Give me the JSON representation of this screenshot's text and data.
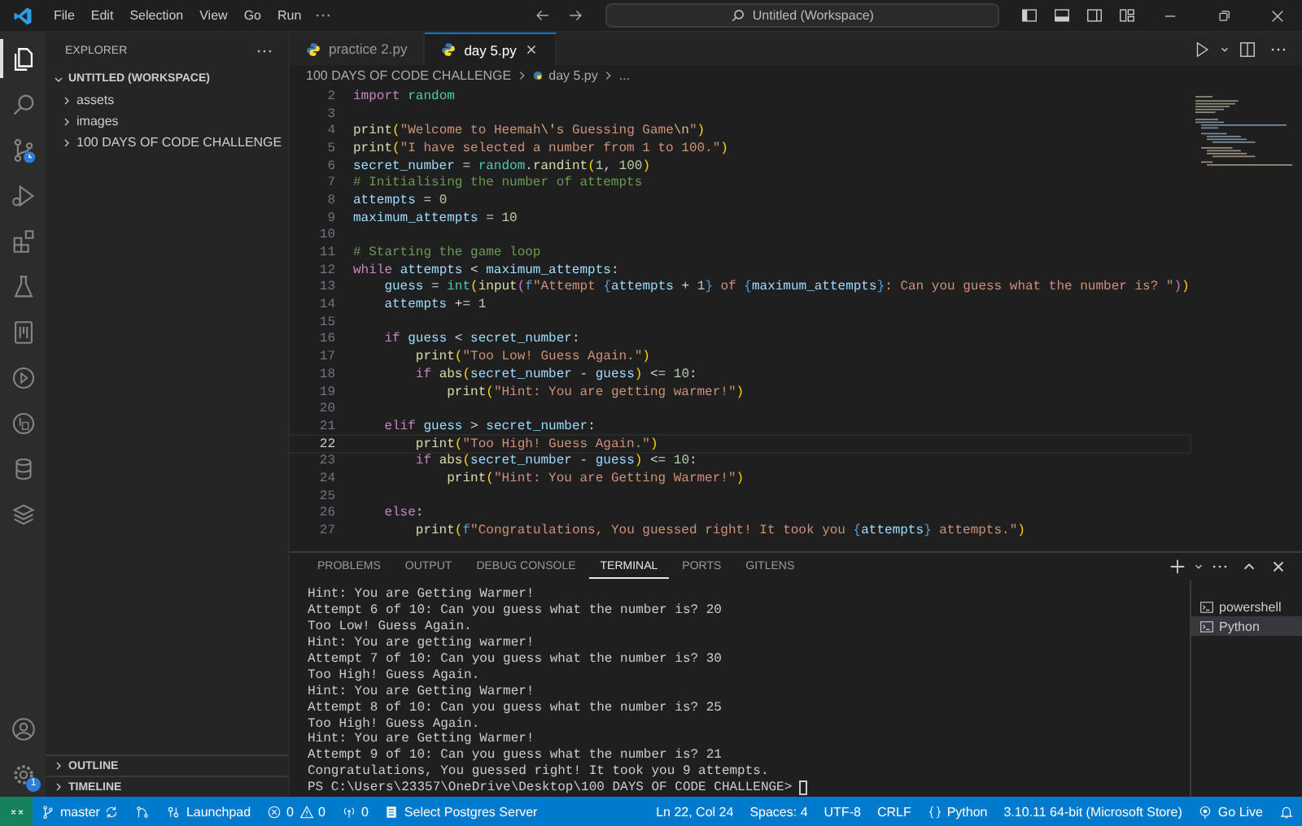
{
  "menu": [
    "File",
    "Edit",
    "Selection",
    "View",
    "Go",
    "Run"
  ],
  "command_center": "Untitled (Workspace)",
  "activity_bar": [
    {
      "kind": "files",
      "selected": true
    },
    {
      "kind": "search",
      "selected": false
    },
    {
      "kind": "branch",
      "selected": false
    },
    {
      "kind": "debug",
      "selected": false
    },
    {
      "kind": "blocks",
      "selected": false
    },
    {
      "kind": "flask",
      "selected": false
    },
    {
      "kind": "notebook",
      "selected": false
    },
    {
      "kind": "playcircle",
      "selected": false
    },
    {
      "kind": "dbcircle",
      "selected": false
    },
    {
      "kind": "database",
      "selected": false
    },
    {
      "kind": "layers",
      "selected": false
    }
  ],
  "settings_badge": "1",
  "sidebar": {
    "title": "EXPLORER",
    "workspace": {
      "label": "UNTITLED (WORKSPACE)",
      "expanded": true,
      "children": [
        {
          "label": "assets",
          "expanded": false
        },
        {
          "label": "images",
          "expanded": false
        },
        {
          "label": "100 DAYS OF CODE CHALLENGE",
          "expanded": false
        }
      ]
    },
    "sections": [
      {
        "label": "OUTLINE",
        "expanded": false
      },
      {
        "label": "TIMELINE",
        "expanded": false
      }
    ]
  },
  "tabs": [
    {
      "label": "practice 2.py",
      "selected": false
    },
    {
      "label": "day 5.py",
      "selected": true
    }
  ],
  "breadcrumb": {
    "folder": "100 DAYS OF CODE CHALLENGE",
    "file": "day 5.py",
    "more": "..."
  },
  "code": [
    {
      "number": "2",
      "current": false,
      "tokens": [
        {
          "kind": "keyword",
          "text": "import "
        },
        {
          "kind": "module",
          "text": "random"
        }
      ]
    },
    {
      "number": "3",
      "current": false
    },
    {
      "number": "4",
      "current": false,
      "tokens": [
        {
          "kind": "function",
          "text": "print"
        },
        {
          "kind": "paren",
          "text": "("
        },
        {
          "kind": "string",
          "text": "\"Welcome to Heemah"
        },
        {
          "kind": "escape",
          "text": "\\'"
        },
        {
          "kind": "string",
          "text": "s Guessing Game"
        },
        {
          "kind": "escape",
          "text": "\\n"
        },
        {
          "kind": "string",
          "text": "\""
        },
        {
          "kind": "paren",
          "text": ")"
        }
      ]
    },
    {
      "number": "5",
      "current": false,
      "tokens": [
        {
          "kind": "function",
          "text": "print"
        },
        {
          "kind": "paren",
          "text": "("
        },
        {
          "kind": "string",
          "text": "\"I have selected a number from 1 to 100.\""
        },
        {
          "kind": "paren",
          "text": ")"
        }
      ]
    },
    {
      "number": "6",
      "current": false,
      "tokens": [
        {
          "kind": "variable",
          "text": "secret_number"
        },
        {
          "kind": "plain",
          "text": " = "
        },
        {
          "kind": "module",
          "text": "random"
        },
        {
          "kind": "plain",
          "text": "."
        },
        {
          "kind": "function",
          "text": "randint"
        },
        {
          "kind": "paren",
          "text": "("
        },
        {
          "kind": "number",
          "text": "1"
        },
        {
          "kind": "plain",
          "text": ", "
        },
        {
          "kind": "number",
          "text": "100"
        },
        {
          "kind": "paren",
          "text": ")"
        }
      ]
    },
    {
      "number": "7",
      "current": false,
      "tokens": [
        {
          "kind": "comment",
          "text": "# Initialising the number of attempts"
        }
      ]
    },
    {
      "number": "8",
      "current": false,
      "tokens": [
        {
          "kind": "variable",
          "text": "attempts"
        },
        {
          "kind": "plain",
          "text": " = "
        },
        {
          "kind": "number",
          "text": "0"
        }
      ]
    },
    {
      "number": "9",
      "current": false,
      "tokens": [
        {
          "kind": "variable",
          "text": "maximum_attempts"
        },
        {
          "kind": "plain",
          "text": " = "
        },
        {
          "kind": "number",
          "text": "10"
        }
      ]
    },
    {
      "number": "10",
      "current": false
    },
    {
      "number": "11",
      "current": false,
      "tokens": [
        {
          "kind": "comment",
          "text": "# Starting the game loop"
        }
      ]
    },
    {
      "number": "12",
      "current": false,
      "tokens": [
        {
          "kind": "keyword",
          "text": "while "
        },
        {
          "kind": "variable",
          "text": "attempts"
        },
        {
          "kind": "plain",
          "text": " < "
        },
        {
          "kind": "variable",
          "text": "maximum_attempts"
        },
        {
          "kind": "plain",
          "text": ":"
        }
      ]
    },
    {
      "number": "13",
      "current": false,
      "tokens": [
        {
          "kind": "variable",
          "text": "    guess"
        },
        {
          "kind": "plain",
          "text": " = "
        },
        {
          "kind": "module",
          "text": "int"
        },
        {
          "kind": "paren",
          "text": "("
        },
        {
          "kind": "function",
          "text": "input"
        },
        {
          "kind": "paren2",
          "text": "("
        },
        {
          "kind": "brace",
          "text": "f"
        },
        {
          "kind": "string",
          "text": "\"Attempt "
        },
        {
          "kind": "brace",
          "text": "{"
        },
        {
          "kind": "variable",
          "text": "attempts"
        },
        {
          "kind": "plain",
          "text": " + "
        },
        {
          "kind": "number",
          "text": "1"
        },
        {
          "kind": "brace",
          "text": "}"
        },
        {
          "kind": "string",
          "text": " of "
        },
        {
          "kind": "brace",
          "text": "{"
        },
        {
          "kind": "variable",
          "text": "maximum_attempts"
        },
        {
          "kind": "brace",
          "text": "}"
        },
        {
          "kind": "string",
          "text": ": Can you guess what the number is? \""
        },
        {
          "kind": "paren2",
          "text": ")"
        },
        {
          "kind": "paren",
          "text": ")"
        }
      ]
    },
    {
      "number": "14",
      "current": false,
      "tokens": [
        {
          "kind": "variable",
          "text": "    attempts"
        },
        {
          "kind": "plain",
          "text": " += "
        },
        {
          "kind": "number",
          "text": "1"
        }
      ]
    },
    {
      "number": "15",
      "current": false
    },
    {
      "number": "16",
      "current": false,
      "tokens": [
        {
          "kind": "keyword",
          "text": "    if "
        },
        {
          "kind": "variable",
          "text": "guess"
        },
        {
          "kind": "plain",
          "text": " < "
        },
        {
          "kind": "variable",
          "text": "secret_number"
        },
        {
          "kind": "plain",
          "text": ":"
        }
      ]
    },
    {
      "number": "17",
      "current": false,
      "tokens": [
        {
          "kind": "function",
          "text": "        print"
        },
        {
          "kind": "paren",
          "text": "("
        },
        {
          "kind": "string",
          "text": "\"Too Low! Guess Again.\""
        },
        {
          "kind": "paren",
          "text": ")"
        }
      ]
    },
    {
      "number": "18",
      "current": false,
      "tokens": [
        {
          "kind": "keyword",
          "text": "        if "
        },
        {
          "kind": "function",
          "text": "abs"
        },
        {
          "kind": "paren",
          "text": "("
        },
        {
          "kind": "variable",
          "text": "secret_number"
        },
        {
          "kind": "plain",
          "text": " - "
        },
        {
          "kind": "variable",
          "text": "guess"
        },
        {
          "kind": "paren",
          "text": ")"
        },
        {
          "kind": "plain",
          "text": " <= "
        },
        {
          "kind": "number",
          "text": "10"
        },
        {
          "kind": "plain",
          "text": ":"
        }
      ]
    },
    {
      "number": "19",
      "current": false,
      "tokens": [
        {
          "kind": "function",
          "text": "            print"
        },
        {
          "kind": "paren",
          "text": "("
        },
        {
          "kind": "string",
          "text": "\"Hint: You are getting warmer!\""
        },
        {
          "kind": "paren",
          "text": ")"
        }
      ]
    },
    {
      "number": "20",
      "current": false
    },
    {
      "number": "21",
      "current": false,
      "tokens": [
        {
          "kind": "keyword",
          "text": "    elif "
        },
        {
          "kind": "variable",
          "text": "guess"
        },
        {
          "kind": "plain",
          "text": " > "
        },
        {
          "kind": "variable",
          "text": "secret_number"
        },
        {
          "kind": "plain",
          "text": ":"
        }
      ]
    },
    {
      "number": "22",
      "current": true,
      "tokens": [
        {
          "kind": "function",
          "text": "        print"
        },
        {
          "kind": "paren",
          "text": "("
        },
        {
          "kind": "string",
          "text": "\"Too High! Guess Again.\""
        },
        {
          "kind": "paren",
          "text": ")"
        }
      ]
    },
    {
      "number": "23",
      "current": false,
      "tokens": [
        {
          "kind": "keyword",
          "text": "        if "
        },
        {
          "kind": "function",
          "text": "abs"
        },
        {
          "kind": "paren",
          "text": "("
        },
        {
          "kind": "variable",
          "text": "secret_number"
        },
        {
          "kind": "plain",
          "text": " - "
        },
        {
          "kind": "variable",
          "text": "guess"
        },
        {
          "kind": "paren",
          "text": ")"
        },
        {
          "kind": "plain",
          "text": " <= "
        },
        {
          "kind": "number",
          "text": "10"
        },
        {
          "kind": "plain",
          "text": ":"
        }
      ]
    },
    {
      "number": "24",
      "current": false,
      "tokens": [
        {
          "kind": "function",
          "text": "            print"
        },
        {
          "kind": "paren",
          "text": "("
        },
        {
          "kind": "string",
          "text": "\"Hint: You are Getting Warmer!\""
        },
        {
          "kind": "paren",
          "text": ")"
        }
      ]
    },
    {
      "number": "25",
      "current": false
    },
    {
      "number": "26",
      "current": false,
      "tokens": [
        {
          "kind": "keyword",
          "text": "    else"
        },
        {
          "kind": "plain",
          "text": ":"
        }
      ]
    },
    {
      "number": "27",
      "current": false,
      "tokens": [
        {
          "kind": "function",
          "text": "        print"
        },
        {
          "kind": "paren",
          "text": "("
        },
        {
          "kind": "brace",
          "text": "f"
        },
        {
          "kind": "string",
          "text": "\"Congratulations, You guessed right! It took you "
        },
        {
          "kind": "brace",
          "text": "{"
        },
        {
          "kind": "variable",
          "text": "attempts"
        },
        {
          "kind": "brace",
          "text": "}"
        },
        {
          "kind": "string",
          "text": " attempts.\""
        },
        {
          "kind": "paren",
          "text": ")"
        }
      ]
    }
  ],
  "panel": {
    "tabs": [
      {
        "label": "PROBLEMS",
        "selected": false
      },
      {
        "label": "OUTPUT",
        "selected": false
      },
      {
        "label": "DEBUG CONSOLE",
        "selected": false
      },
      {
        "label": "TERMINAL",
        "selected": true
      },
      {
        "label": "PORTS",
        "selected": false
      },
      {
        "label": "GITLENS",
        "selected": false
      }
    ],
    "terminal_lines": [
      "Hint: You are Getting Warmer!",
      "Attempt 6 of 10: Can you guess what the number is? 20",
      "Too Low! Guess Again.",
      "Hint: You are getting warmer!",
      "Attempt 7 of 10: Can you guess what the number is? 30",
      "Too High! Guess Again.",
      "Hint: You are Getting Warmer!",
      "Attempt 8 of 10: Can you guess what the number is? 25",
      "Too High! Guess Again.",
      "Hint: You are Getting Warmer!",
      "Attempt 9 of 10: Can you guess what the number is? 21",
      "Congratulations, You guessed right! It took you 9 attempts.",
      "PS C:\\Users\\23357\\OneDrive\\Desktop\\100 DAYS OF CODE CHALLENGE> "
    ],
    "terminals": [
      {
        "label": "powershell",
        "selected": false
      },
      {
        "label": "Python",
        "selected": true
      }
    ]
  },
  "status_bar": {
    "branch": "master",
    "launchpad": "Launchpad",
    "errors": "0",
    "warnings": "0",
    "ports": "0",
    "postgres": "Select Postgres Server",
    "position": "Ln 22, Col 24",
    "spaces": "Spaces: 4",
    "encoding": "UTF-8",
    "eol": "CRLF",
    "language": "Python",
    "interpreter": "3.10.11 64-bit (Microsoft Store)",
    "live": "Go Live"
  }
}
